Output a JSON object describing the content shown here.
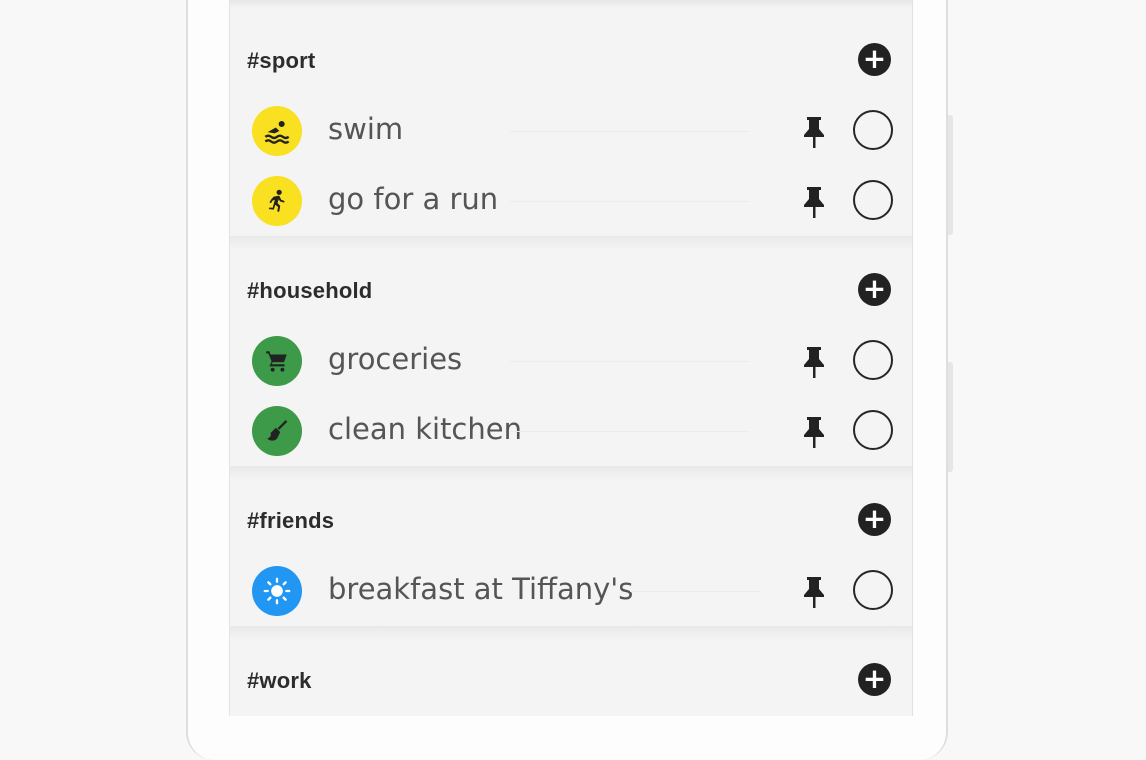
{
  "colors": {
    "sport": "#f9e021",
    "household": "#3c9a48",
    "friends": "#2196f3",
    "dark": "#222222"
  },
  "sections": [
    {
      "title": "#sport",
      "add_icon": "plus-circle-icon",
      "tasks": [
        {
          "label": "swim",
          "icon": "swimmer-icon",
          "pin_icon": "pin-icon"
        },
        {
          "label": "go for a run",
          "icon": "runner-icon",
          "pin_icon": "pin-icon"
        }
      ]
    },
    {
      "title": "#household",
      "add_icon": "plus-circle-icon",
      "tasks": [
        {
          "label": "groceries",
          "icon": "shopping-cart-icon",
          "pin_icon": "pin-icon"
        },
        {
          "label": "clean kitchen",
          "icon": "broom-icon",
          "pin_icon": "pin-icon"
        }
      ]
    },
    {
      "title": "#friends",
      "add_icon": "plus-circle-icon",
      "tasks": [
        {
          "label": "breakfast at Tiffany's",
          "icon": "sun-icon",
          "pin_icon": "pin-icon"
        }
      ]
    },
    {
      "title": "#work",
      "add_icon": "plus-circle-icon",
      "tasks": []
    }
  ]
}
